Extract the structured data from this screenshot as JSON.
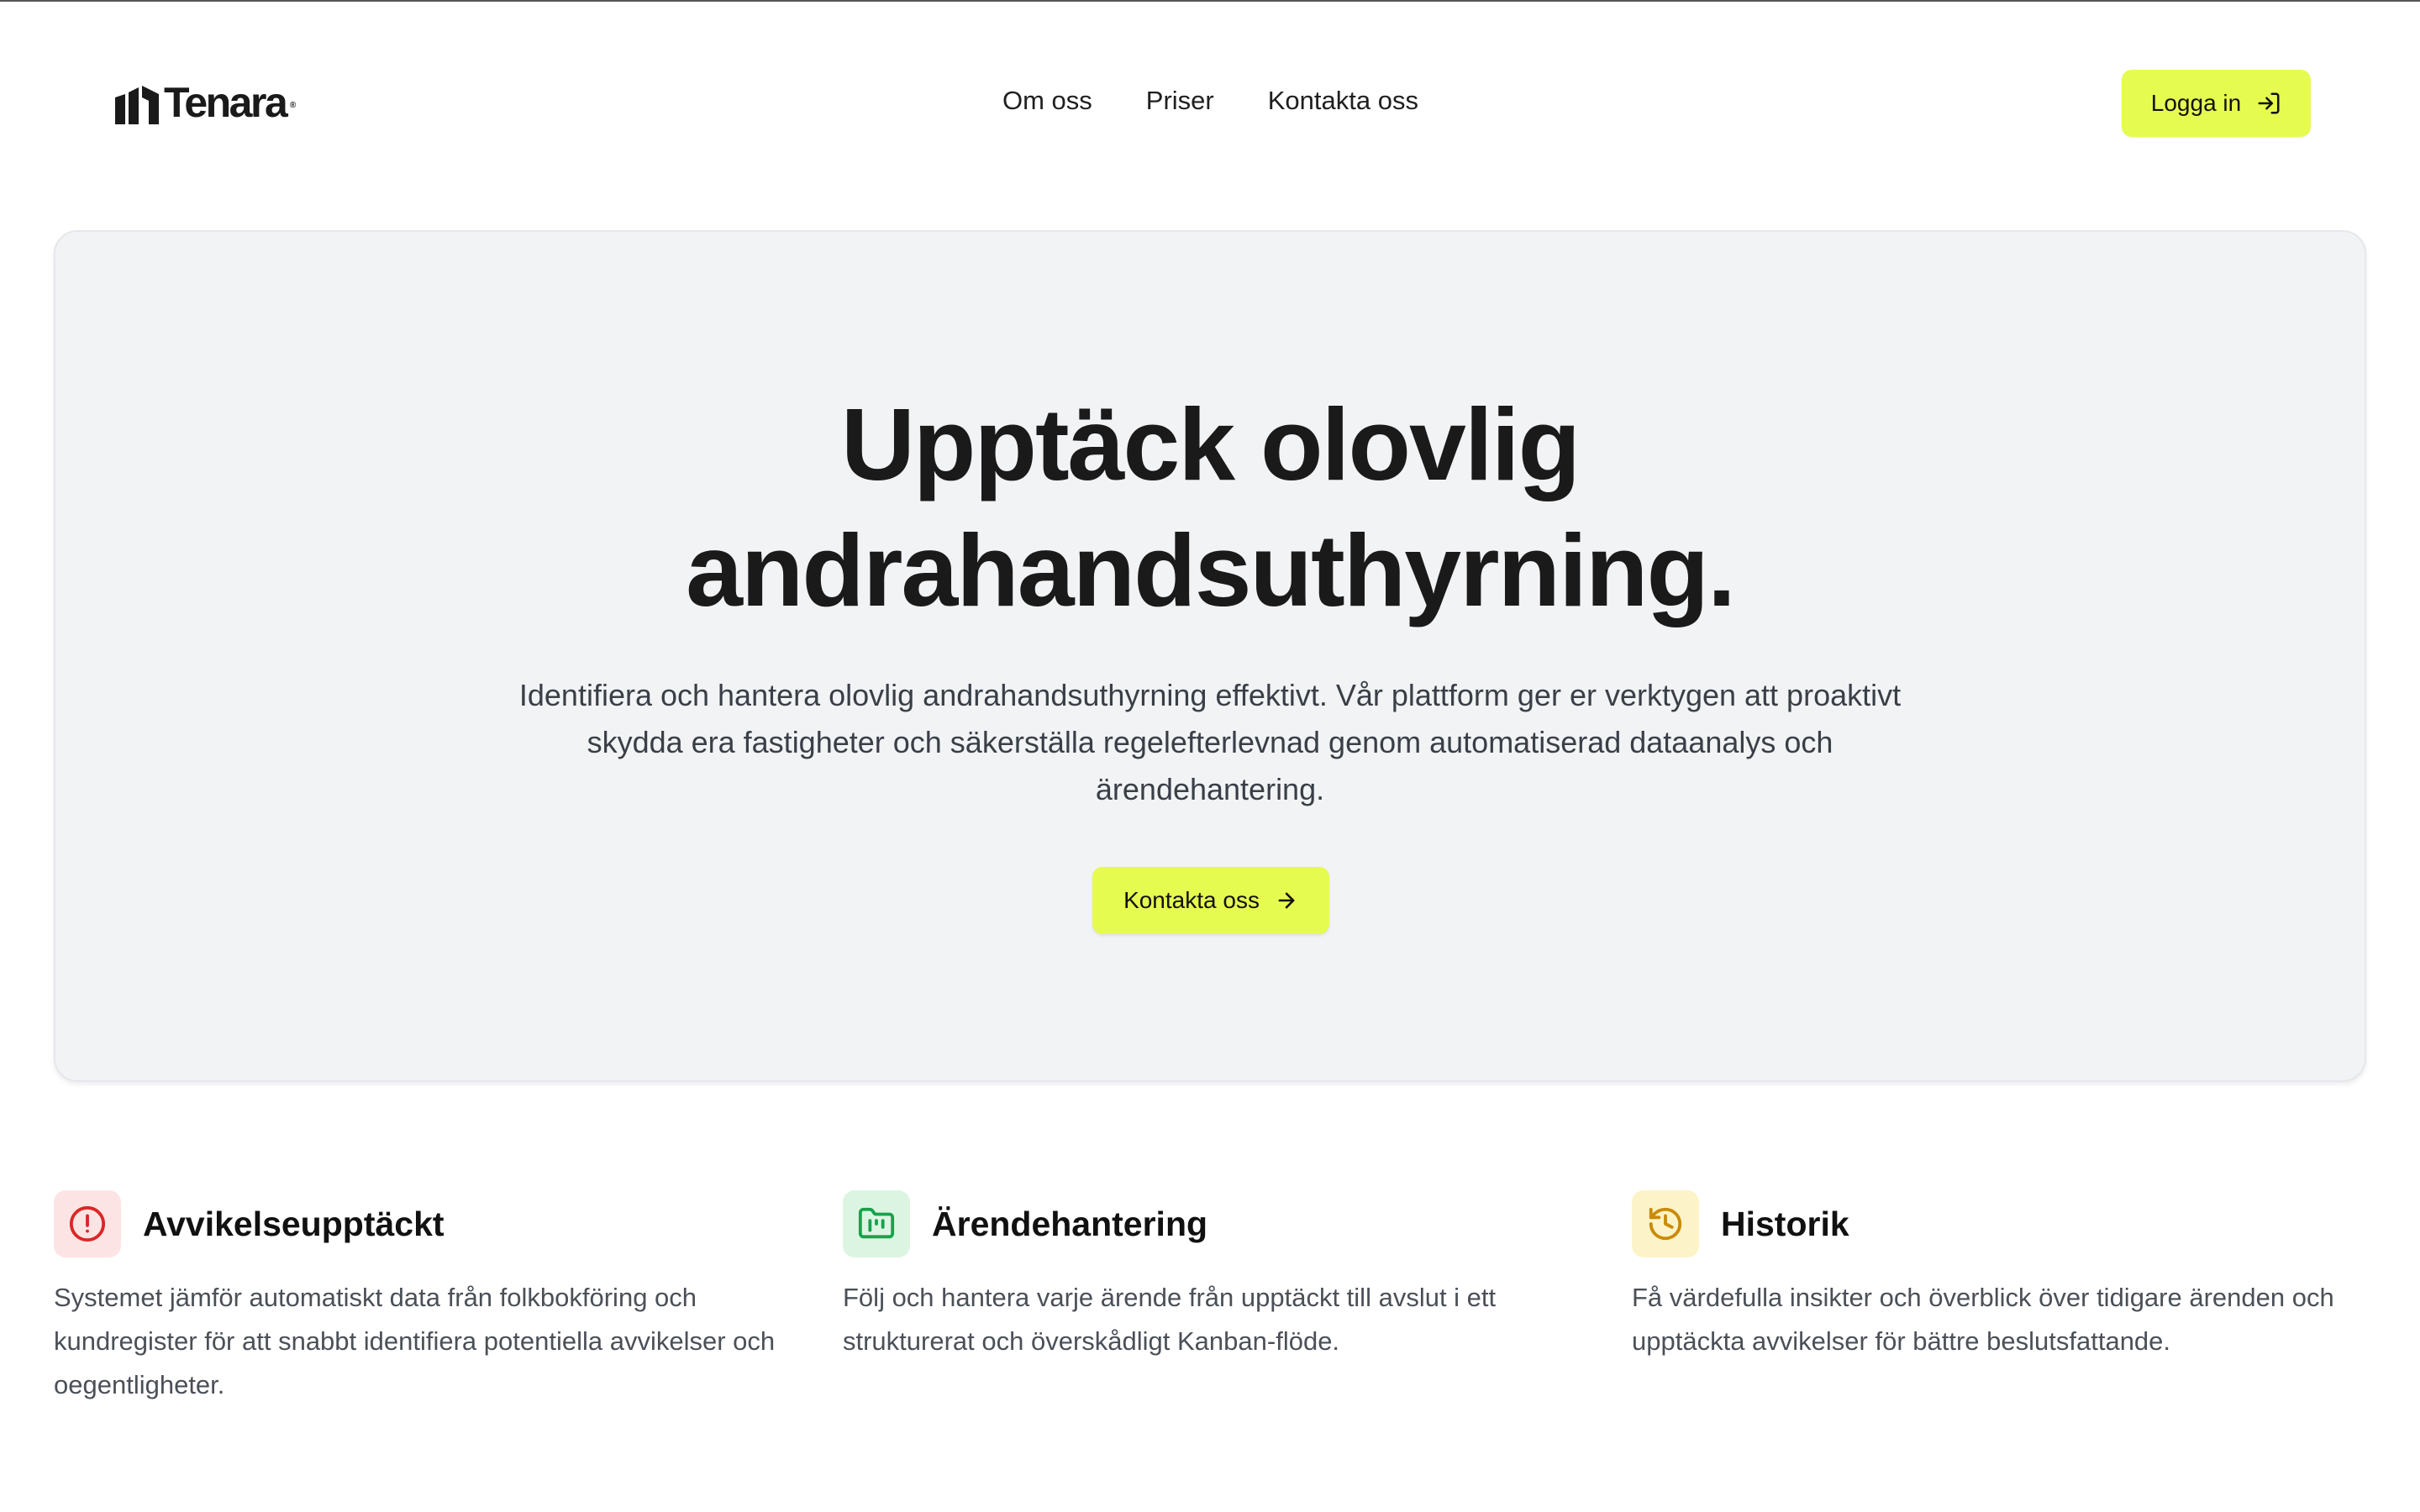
{
  "brand": {
    "name": "Tenara",
    "mark": "®"
  },
  "nav": {
    "items": [
      {
        "label": "Om oss"
      },
      {
        "label": "Priser"
      },
      {
        "label": "Kontakta oss"
      }
    ],
    "login_label": "Logga in"
  },
  "hero": {
    "title_line1": "Upptäck olovlig",
    "title_line2": "andrahandsuthyrning.",
    "description": "Identifiera och hantera olovlig andrahandsuthyrning effektivt. Vår plattform ger er verktygen att proaktivt skydda era fastigheter och säkerställa regelefterlevnad genom automatiserad dataanalys och ärendehantering.",
    "cta_label": "Kontakta oss"
  },
  "features": [
    {
      "title": "Avvikelseupptäckt",
      "text": "Systemet jämför automatiskt data från folkbokföring och kundregister för att snabbt identifiera potentiella avvikelser och oegentligheter.",
      "icon": "alert-circle-icon",
      "icon_bg": "#fde4e4",
      "icon_color": "#dc2626"
    },
    {
      "title": "Ärendehantering",
      "text": "Följ och hantera varje ärende från upptäckt till avslut i ett strukturerat och överskådligt Kanban-flöde.",
      "icon": "kanban-folder-icon",
      "icon_bg": "#dcf5e3",
      "icon_color": "#16a34a"
    },
    {
      "title": "Historik",
      "text": "Få värdefulla insikter och överblick över tidigare ärenden och upptäckta avvikelser för bättre beslutsfattande.",
      "icon": "history-icon",
      "icon_bg": "#fdf3c8",
      "icon_color": "#ca8a04"
    }
  ],
  "colors": {
    "accent": "#e6fb4f",
    "hero_bg": "#f2f3f5",
    "text": "#1a1a1a"
  }
}
